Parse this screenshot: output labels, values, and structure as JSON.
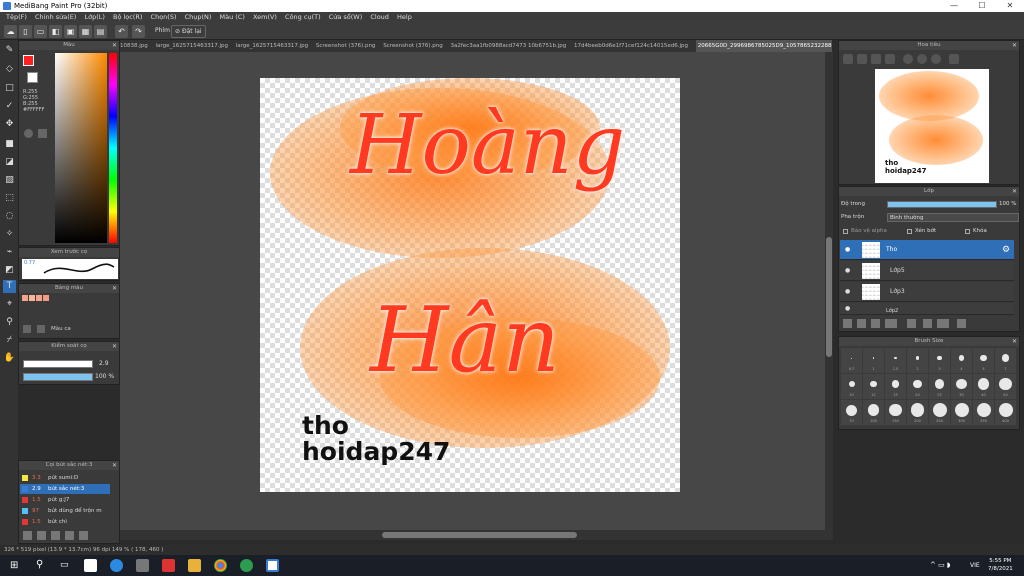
{
  "window": {
    "title": "MediBang Paint Pro (32bit)",
    "min": "—",
    "max": "☐",
    "close": "✕"
  },
  "menu": [
    "Tệp(F)",
    "Chỉnh sửa(E)",
    "Lớp(L)",
    "Bộ lọc(R)",
    "Chọn(S)",
    "Chụp(N)",
    "Màu (C)",
    "Xem(V)",
    "Công cụ(T)",
    "Cửa sổ(W)",
    "Cloud",
    "Help"
  ],
  "toolbar": {
    "pen_label": "Phím",
    "snap_label": "Đặt lại"
  },
  "tabs": [
    "10838.jpg",
    "large_1625715463317.jpg",
    "large_1625715463317.jpg",
    "Screenshot (376).png",
    "Screenshot (376).png",
    "3a2fec3aa1fb0988acd7473 10b6751b.jpg",
    "17d4beeb0d6e1f71cef124c14015ed6.jpg",
    "20665G0D_2996986785025D9_10578652322886155031_n.bmp"
  ],
  "color_panel": {
    "title": "Màu",
    "r": "R:255",
    "g": "G:255",
    "b": "B:255",
    "hex": "#FFFFFF"
  },
  "brush_preview": {
    "title": "Xem trước cọ",
    "size": "0.77"
  },
  "palette": {
    "title": "Bảng màu",
    "label": "Màu ca",
    "colors": [
      "#f4a38d",
      "#f7b79f",
      "#f4a38d",
      "#f49c84"
    ]
  },
  "brush_control": {
    "title": "Kiểm soát cọ",
    "size": "2.9",
    "opacity": "100 %"
  },
  "brush_list": {
    "title": "Cọi bút sắc nét:3",
    "items": [
      {
        "num": "3.3",
        "name": "pút sumi:D",
        "color": "#f5e642"
      },
      {
        "num": "2.9",
        "name": "bút sắc nét:3",
        "color": "#3a7bd5",
        "active": true
      },
      {
        "num": "1.5",
        "name": "pút g:J7",
        "color": "#e03838"
      },
      {
        "num": "97",
        "name": "bút dùng để trộn m",
        "color": "#4fc3f7"
      },
      {
        "num": "1.5",
        "name": "bút chì",
        "color": "#e03838"
      }
    ]
  },
  "artwork": {
    "word1": "Hoàng",
    "word2": "Hân",
    "sig_line1": "tho",
    "sig_line2": "hoidap247"
  },
  "navigator": {
    "title": "Hoa tiêu"
  },
  "layers": {
    "title": "Lớp",
    "opacity_label": "Độ trong",
    "opacity_value": "100 %",
    "blend_label": "Pha trộn",
    "blend_value": "Bình thường",
    "protect_alpha": "Bảo vệ alpha",
    "clip": "Xén bớt",
    "lock": "Khóa",
    "rows": [
      {
        "name": "Tho",
        "active": true
      },
      {
        "name": "Lớp5",
        "active": false
      },
      {
        "name": "Lớp3",
        "active": false
      },
      {
        "name": "Lớp2",
        "active": false
      }
    ]
  },
  "brush_size": {
    "title": "Brush Size",
    "rows": [
      [
        "0.7",
        "1",
        "1.5",
        "2",
        "3",
        "4",
        "5",
        "7"
      ],
      [
        "10",
        "12",
        "15",
        "20",
        "25",
        "30",
        "40",
        "50"
      ],
      [
        "70",
        "100",
        "150",
        "200",
        "250",
        "300",
        "350",
        "400"
      ]
    ]
  },
  "status": {
    "text": "326 * 519 pixel  (13.9 * 13.7cm)  96 dpi  149 %  ( 178, 460 )"
  },
  "taskbar": {
    "time": "5:55 PM",
    "date": "7/8/2021",
    "lang": "VIE"
  }
}
